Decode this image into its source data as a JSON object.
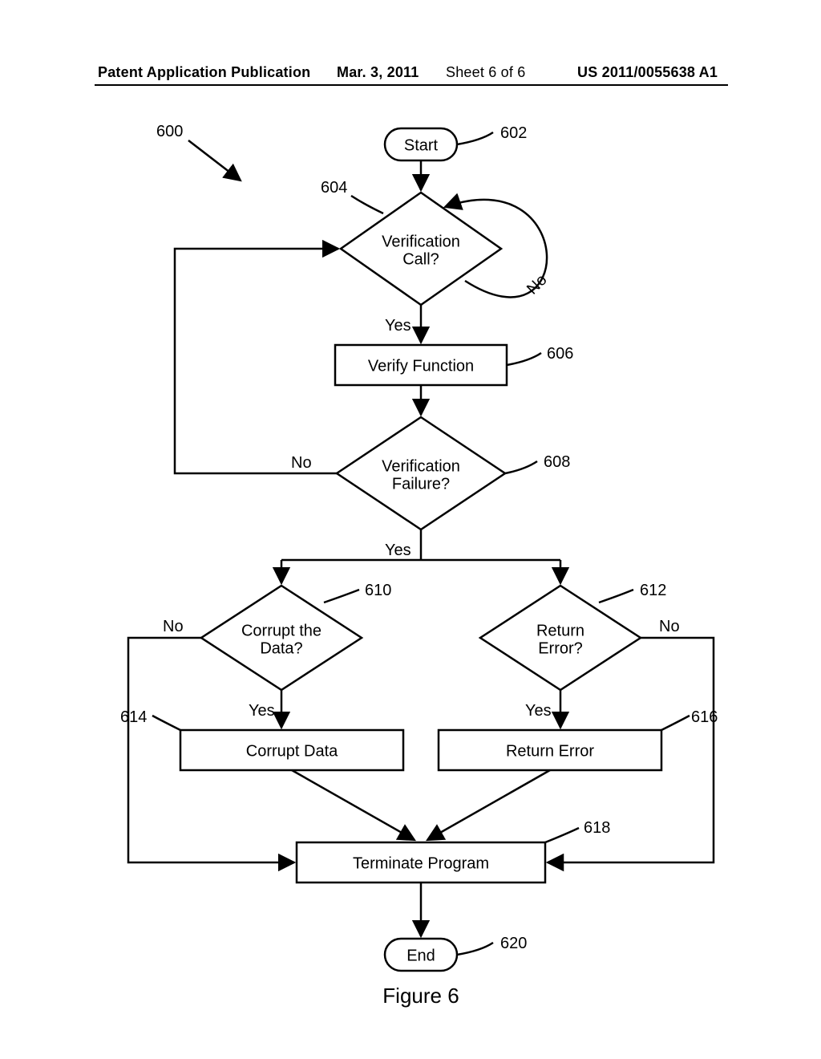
{
  "header": {
    "pub": "Patent Application Publication",
    "date": "Mar. 3, 2011",
    "sheet": "Sheet 6 of 6",
    "docnum": "US 2011/0055638 A1"
  },
  "refs": {
    "r600": "600",
    "r602": "602",
    "r604": "604",
    "r606": "606",
    "r608": "608",
    "r610": "610",
    "r612": "612",
    "r614": "614",
    "r616": "616",
    "r618": "618",
    "r620": "620"
  },
  "nodes": {
    "start": "Start",
    "verif_call_l1": "Verification",
    "verif_call_l2": "Call?",
    "verify_fn": "Verify Function",
    "verif_fail_l1": "Verification",
    "verif_fail_l2": "Failure?",
    "corrupt_q_l1": "Corrupt the",
    "corrupt_q_l2": "Data?",
    "return_err_q_l1": "Return",
    "return_err_q_l2": "Error?",
    "corrupt_data": "Corrupt Data",
    "return_error": "Return Error",
    "terminate": "Terminate Program",
    "end": "End"
  },
  "labels": {
    "yes": "Yes",
    "no": "No"
  },
  "figure": "Figure 6"
}
